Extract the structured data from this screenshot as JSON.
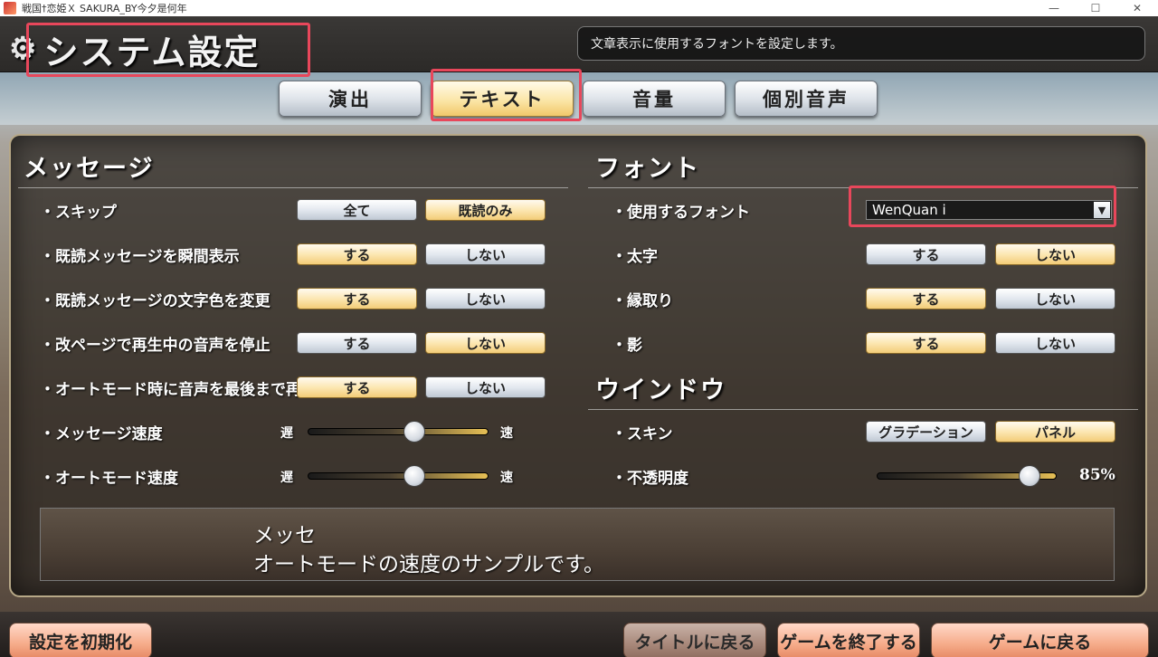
{
  "window": {
    "title": "戦国†恋姫Ｘ SAKURA_BY今夕是何年",
    "controls": {
      "minimize": "—",
      "maximize": "☐",
      "close": "✕"
    }
  },
  "header": {
    "title": "システム設定",
    "description": "文章表示に使用するフォントを設定します。"
  },
  "tabs": [
    {
      "label": "演出",
      "active": false
    },
    {
      "label": "テキスト",
      "active": true
    },
    {
      "label": "音量",
      "active": false
    },
    {
      "label": "個別音声",
      "active": false
    }
  ],
  "message_section": {
    "title": "メッセージ",
    "rows": [
      {
        "label": "・スキップ",
        "options": [
          "全て",
          "既読のみ"
        ],
        "selected": 1
      },
      {
        "label": "・既読メッセージを瞬間表示",
        "options": [
          "する",
          "しない"
        ],
        "selected": 0
      },
      {
        "label": "・既読メッセージの文字色を変更",
        "options": [
          "する",
          "しない"
        ],
        "selected": 0
      },
      {
        "label": "・改ページで再生中の音声を停止",
        "options": [
          "する",
          "しない"
        ],
        "selected": 1
      },
      {
        "label": "・オートモード時に音声を最後まで再生",
        "options": [
          "する",
          "しない"
        ],
        "selected": 0
      }
    ],
    "sliders": [
      {
        "label": "・メッセージ速度",
        "min_label": "遅",
        "max_label": "速",
        "value": 0.59
      },
      {
        "label": "・オートモード速度",
        "min_label": "遅",
        "max_label": "速",
        "value": 0.59
      }
    ]
  },
  "font_section": {
    "title": "フォント",
    "font_select": {
      "label": "・使用するフォント",
      "value": "WenQuan  i",
      "arrow": "▼"
    },
    "rows": [
      {
        "label": "・太字",
        "options": [
          "する",
          "しない"
        ],
        "selected": 1
      },
      {
        "label": "・縁取り",
        "options": [
          "する",
          "しない"
        ],
        "selected": 0
      },
      {
        "label": "・影",
        "options": [
          "する",
          "しない"
        ],
        "selected": 0
      }
    ]
  },
  "window_section": {
    "title": "ウインドウ",
    "skin": {
      "label": "・スキン",
      "options": [
        "グラデーション",
        "パネル"
      ],
      "selected": 1
    },
    "opacity": {
      "label": "・不透明度",
      "value": 0.85,
      "value_label": "85%"
    }
  },
  "preview": {
    "name": "メッセ",
    "text": "オートモードの速度のサンプルです。"
  },
  "footer": {
    "reset": "設定を初期化",
    "back_to_title": "タイトルに戻る",
    "quit_game": "ゲームを終了する",
    "return_to_game": "ゲームに戻る"
  },
  "colors": {
    "highlight": "#e8475b",
    "selected_option": "#f3cc78",
    "unselected_option": "#bfc8d3"
  }
}
